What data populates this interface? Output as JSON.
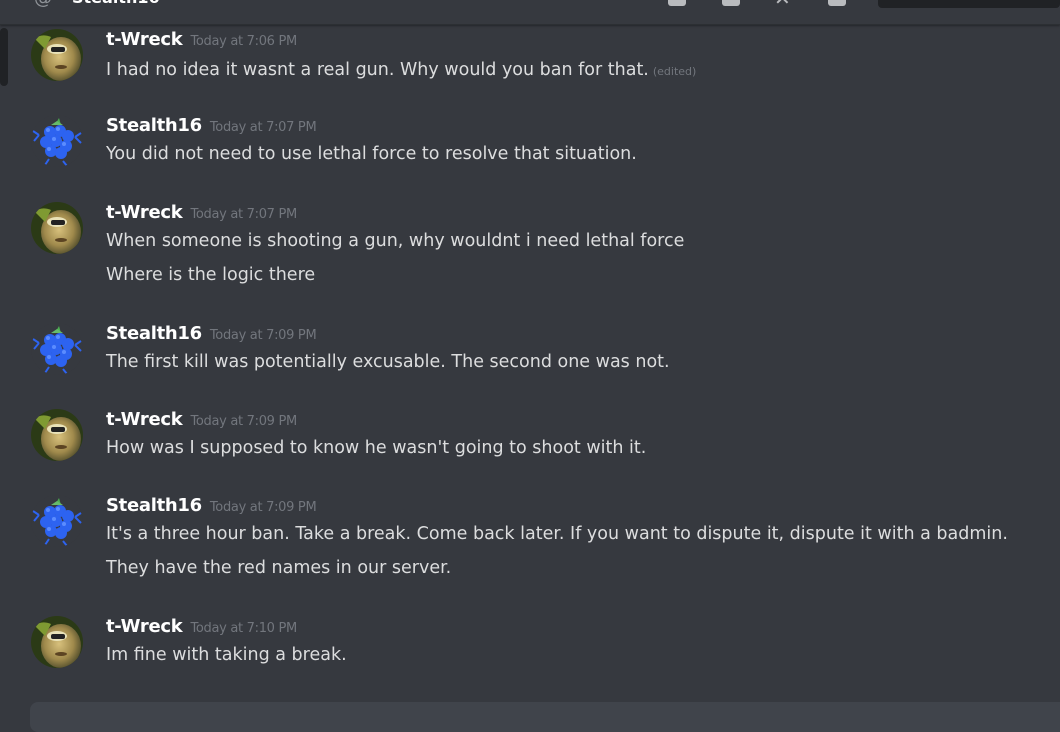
{
  "header": {
    "channel_name": "Stealth16"
  },
  "users": {
    "twreck": {
      "name": "t-Wreck",
      "avatar": "character-face-avatar"
    },
    "stealth": {
      "name": "Stealth16",
      "avatar": "blue-raspberry-avatar"
    }
  },
  "messages": [
    {
      "author": "t-Wreck",
      "timestamp": "Today at 7:06 PM",
      "lines": [
        "I had no idea it wasnt a real gun.  Why would you ban for that."
      ],
      "edited": "(edited)"
    },
    {
      "author": "Stealth16",
      "timestamp": "Today at 7:07 PM",
      "lines": [
        "You did not need to use lethal force to resolve that situation."
      ]
    },
    {
      "author": "t-Wreck",
      "timestamp": "Today at 7:07 PM",
      "lines": [
        "When someone is shooting a gun, why wouldnt i need lethal force",
        "Where is the logic there"
      ]
    },
    {
      "author": "Stealth16",
      "timestamp": "Today at 7:09 PM",
      "lines": [
        "The first kill was potentially excusable. The second one was not."
      ]
    },
    {
      "author": "t-Wreck",
      "timestamp": "Today at 7:09 PM",
      "lines": [
        "How was I supposed to know he wasn't going to shoot with it."
      ]
    },
    {
      "author": "Stealth16",
      "timestamp": "Today at 7:09 PM",
      "lines": [
        "It's a three hour ban. Take a break. Come back later. If you want to dispute it, dispute it with a badmin.",
        "They have the red names in our server."
      ]
    },
    {
      "author": "t-Wreck",
      "timestamp": "Today at 7:10 PM",
      "lines": [
        "Im fine with taking a break."
      ]
    }
  ]
}
